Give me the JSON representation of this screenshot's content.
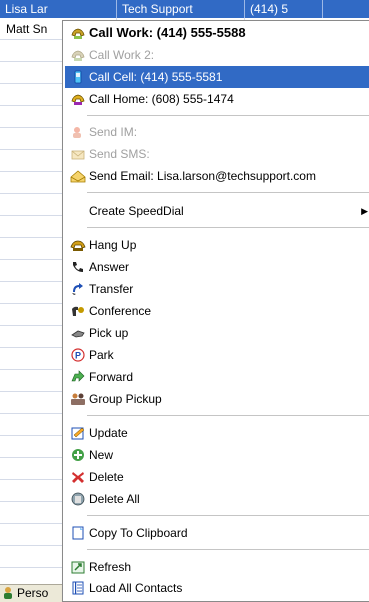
{
  "grid": {
    "header_cells": [
      "Lisa Lar",
      "Tech Support",
      "(414) 5"
    ],
    "rows": [
      "Matt Sn"
    ],
    "bottom_tab_label": "Perso"
  },
  "menu": {
    "call_work": "Call Work: (414) 555-5588",
    "call_work2": "Call Work 2:",
    "call_cell": "Call Cell: (414) 555-5581",
    "call_home": "Call Home: (608) 555-1474",
    "send_im": "Send IM:",
    "send_sms": "Send SMS:",
    "send_email": "Send Email: Lisa.larson@techsupport.com",
    "create_speeddial": "Create SpeedDial",
    "submenu_arrow": "▶",
    "hang_up": "Hang Up",
    "answer": "Answer",
    "transfer": "Transfer",
    "conference": "Conference",
    "pick_up": "Pick up",
    "park": "Park",
    "forward": "Forward",
    "group_pickup": "Group Pickup",
    "update": "Update",
    "new": "New",
    "delete": "Delete",
    "delete_all": "Delete All",
    "copy_to_clipboard": "Copy To Clipboard",
    "refresh": "Refresh",
    "load_all_contacts": "Load All Contacts"
  },
  "icons": {
    "call_work": "phone-gold-icon",
    "call_work2": "phone-disabled-icon",
    "call_cell": "mobile-phone-icon",
    "call_home": "phone-home-icon",
    "send_im": "instant-message-icon",
    "send_sms": "sms-envelope-icon",
    "send_email": "email-icon",
    "hang_up": "hang-up-icon",
    "answer": "answer-icon",
    "transfer": "transfer-icon",
    "conference": "conference-icon",
    "pick_up": "pickup-icon",
    "park": "park-icon",
    "forward": "forward-icon",
    "group_pickup": "group-pickup-icon",
    "update": "update-icon",
    "new": "new-plus-icon",
    "delete": "delete-x-icon",
    "delete_all": "delete-all-icon",
    "copy_to_clipboard": "clipboard-icon",
    "refresh": "refresh-icon",
    "load_all_contacts": "contacts-list-icon"
  },
  "colors": {
    "highlight": "#316ac5",
    "disabled_text": "#a0a0a0",
    "menu_border": "#8a8a8a"
  }
}
